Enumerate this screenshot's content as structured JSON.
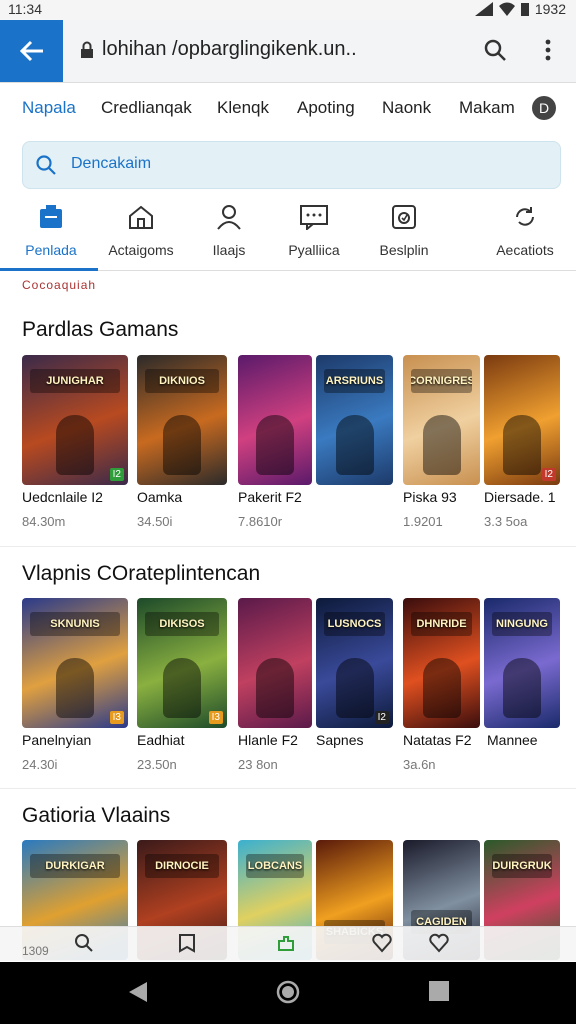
{
  "status_bar": {
    "time": "11:34",
    "battery": "1932"
  },
  "toolbar": {
    "url": "lohihan /opbarglingikenk.un.."
  },
  "categories": [
    "Napala",
    "Credlianqak",
    "Klenqk",
    "Apoting",
    "Naonk",
    "Makam"
  ],
  "categories_more": "D",
  "search": {
    "placeholder": "Dencakaim"
  },
  "nav": [
    {
      "label": "Penlada",
      "icon": "store-icon"
    },
    {
      "label": "Actaigoms",
      "icon": "home-icon"
    },
    {
      "label": "Ilaajs",
      "icon": "person-icon"
    },
    {
      "label": "Pyalliica",
      "icon": "message-icon"
    },
    {
      "label": "Beslplin",
      "icon": "badge-icon"
    },
    {
      "label": "Aecatiots",
      "icon": "refresh-icon"
    }
  ],
  "cut_heading": "Cocoaquiah",
  "sections": [
    {
      "title": "Pardlas Gamans",
      "games": [
        {
          "name": "Uedcnlaile I2",
          "size": "84.30m",
          "logo": "JUNIGHAR",
          "rating": "I2",
          "c1": "#3a2a4a",
          "c2": "#b84a20"
        },
        {
          "name": "Oamka",
          "size": "34.50i",
          "logo": "DIKNIOS",
          "rating": "",
          "c1": "#2b2a2a",
          "c2": "#c86a20"
        },
        {
          "name": "Pakerit F2",
          "size": "7.8610r",
          "logo": "",
          "rating": "",
          "c1": "#5a1a6a",
          "c2": "#d04080"
        },
        {
          "name": "",
          "size": "",
          "logo": "ARSRIUNS",
          "rating": "",
          "c1": "#1d3a6a",
          "c2": "#3a7ac0"
        },
        {
          "name": "Piska    93",
          "size": "1.9201",
          "logo": "CORNIGRES",
          "rating": "",
          "c1": "#c89050",
          "c2": "#f0d0a0"
        },
        {
          "name": "Diersade. 1",
          "size": "3.3 5oa",
          "logo": "",
          "rating": "I2",
          "c1": "#7a3a10",
          "c2": "#f0a030"
        }
      ]
    },
    {
      "title": "Vlapnis COrateplintencan",
      "games": [
        {
          "name": "Panelnyian",
          "size": "24.30i",
          "logo": "SKNUNIS",
          "rating": "I3",
          "c1": "#2a3a8a",
          "c2": "#e0a040"
        },
        {
          "name": "Eadhiat",
          "size": "23.50n",
          "logo": "DIKISOS",
          "rating": "I3",
          "c1": "#1d4a2a",
          "c2": "#8ab040"
        },
        {
          "name": "Hlanle    F2",
          "size": "23 8on",
          "logo": "",
          "rating": "",
          "c1": "#5a1a4a",
          "c2": "#c04060"
        },
        {
          "name": "Sapnes",
          "size": "",
          "logo": "LUSNOCS",
          "rating": "I2",
          "c1": "#0d1a3a",
          "c2": "#3a4a9a"
        },
        {
          "name": "Natatas F2",
          "size": "3a.6n",
          "logo": "DHNRIDE",
          "rating": "",
          "c1": "#3a0d0d",
          "c2": "#e05020"
        },
        {
          "name": "Mannee",
          "size": "",
          "logo": "NINGUNG",
          "rating": "",
          "c1": "#1a2a6a",
          "c2": "#7a6ad0"
        }
      ]
    },
    {
      "title": "Gatioria Vlaains",
      "games": [
        {
          "name": "",
          "size": "",
          "logo": "DURKIGAR",
          "rating": "",
          "c1": "#2a7ac0",
          "c2": "#e0a030"
        },
        {
          "name": "",
          "size": "",
          "logo": "DIRNOCIE",
          "rating": "",
          "c1": "#3a1a1a",
          "c2": "#b04020"
        },
        {
          "name": "",
          "size": "",
          "logo": "LOBCANS",
          "rating": "",
          "c1": "#3ab0d0",
          "c2": "#e0d060"
        },
        {
          "name": "",
          "size": "",
          "logo": "SHABICKS",
          "rating": "",
          "c1": "#5a1a0a",
          "c2": "#f0a020"
        },
        {
          "name": "",
          "size": "",
          "logo": "CAGIDEN",
          "rating": "",
          "c1": "#1a1a2a",
          "c2": "#8090a0"
        },
        {
          "name": "",
          "size": "",
          "logo": "DUIRGRUK",
          "rating": "",
          "c1": "#2a5a2a",
          "c2": "#d04060"
        }
      ]
    }
  ],
  "bottom_cut": "1309"
}
